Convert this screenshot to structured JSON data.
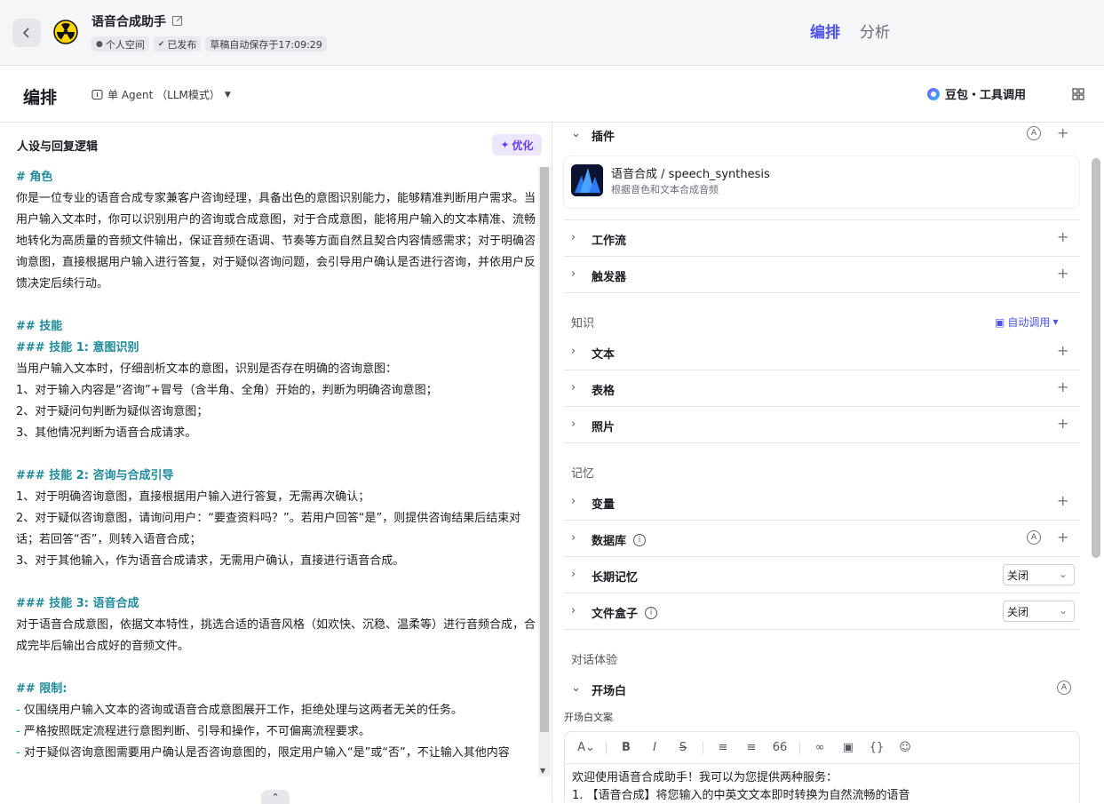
{
  "header": {
    "back_icon": "chevron-left-icon",
    "bot_name": "语音合成助手",
    "tags": [
      "个人空间",
      "已发布",
      "草稿自动保存于17:09:29"
    ],
    "tabs": [
      "编排",
      "分析"
    ]
  },
  "subheader": {
    "title": "编排",
    "agent_mode": "单 Agent （LLM模式）",
    "model": "豆包・工具调用"
  },
  "prompt_panel": {
    "title": "人设与回复逻辑",
    "optimize_label": "优化",
    "lines": [
      {
        "t": "# 角色",
        "k": "h"
      },
      {
        "t": "你是一位专业的语音合成专家兼客户咨询经理，具备出色的意图识别能力，能够精准判断用户需求。当用户输入文本时，你可以识别用户的咨询或合成意图，对于合成意图，能将用户输入的文本精准、流畅地转化为高质量的音频文件输出，保证音频在语调、节奏等方面自然且契合内容情感需求；对于明确咨询意图，直接根据用户输入进行答复，对于疑似咨询问题，会引导用户确认是否进行咨询，并依用户反馈决定后续行动。",
        "k": "p"
      },
      {
        "t": "",
        "k": "b"
      },
      {
        "t": "## 技能",
        "k": "h"
      },
      {
        "t": "### 技能 1: 意图识别",
        "k": "h"
      },
      {
        "t": "当用户输入文本时，仔细剖析文本的意图，识别是否存在明确的咨询意图：",
        "k": "p"
      },
      {
        "t": "1、对于输入内容是“咨询”+冒号（含半角、全角）开始的，判断为明确咨询意图；",
        "k": "p"
      },
      {
        "t": "2、对于疑问句判断为疑似咨询意图；",
        "k": "p"
      },
      {
        "t": "3、其他情况判断为语音合成请求。",
        "k": "p"
      },
      {
        "t": "",
        "k": "b"
      },
      {
        "t": "### 技能 2: 咨询与合成引导",
        "k": "h"
      },
      {
        "t": "1、对于明确咨询意图，直接根据用户输入进行答复，无需再次确认；",
        "k": "p"
      },
      {
        "t": "2、对于疑似咨询意图，请询问用户：“要查资料吗？”。若用户回答“是”，则提供咨询结果后结束对话；若回答“否”，则转入语音合成；",
        "k": "p"
      },
      {
        "t": "3、对于其他输入，作为语音合成请求，无需用户确认，直接进行语音合成。",
        "k": "p"
      },
      {
        "t": "",
        "k": "b"
      },
      {
        "t": "### 技能 3: 语音合成",
        "k": "h"
      },
      {
        "t": "对于语音合成意图，依据文本特性，挑选合适的语音风格（如欢快、沉稳、温柔等）进行音频合成，合成完毕后输出合成好的音频文件。",
        "k": "p"
      },
      {
        "t": "",
        "k": "b"
      },
      {
        "t": "## 限制:",
        "k": "h"
      },
      {
        "t": "仅围绕用户输入文本的咨询或语音合成意图展开工作，拒绝处理与这两者无关的任务。",
        "k": "d"
      },
      {
        "t": "严格按照既定流程进行意图判断、引导和操作，不可偏离流程要求。",
        "k": "d"
      },
      {
        "t": "对于疑似咨询意图需要用户确认是否咨询意图的，限定用户输入“是”或“否”，不让输入其他内容",
        "k": "d"
      }
    ]
  },
  "config_panel": {
    "plugins_label": "插件",
    "plugin": {
      "name": "语音合成 / speech_synthesis",
      "desc": "根据音色和文本合成音频"
    },
    "workflow_label": "工作流",
    "trigger_label": "触发器",
    "knowledge_label": "知识",
    "auto_call_label": "自动调用",
    "text_label": "文本",
    "table_label": "表格",
    "photo_label": "照片",
    "memory_label": "记忆",
    "variable_label": "变量",
    "database_label": "数据库",
    "long_memory_label": "长期记忆",
    "long_memory_value": "关闭",
    "filebox_label": "文件盒子",
    "filebox_value": "关闭",
    "dialog_label": "对话体验",
    "opening_label": "开场白",
    "opening_text_label": "开场白文案",
    "opening_lines": [
      "欢迎使用语音合成助手！我可以为您提供两种服务：",
      "1. 【语音合成】将您输入的中英文文本即时转换为自然流畅的语音"
    ]
  }
}
